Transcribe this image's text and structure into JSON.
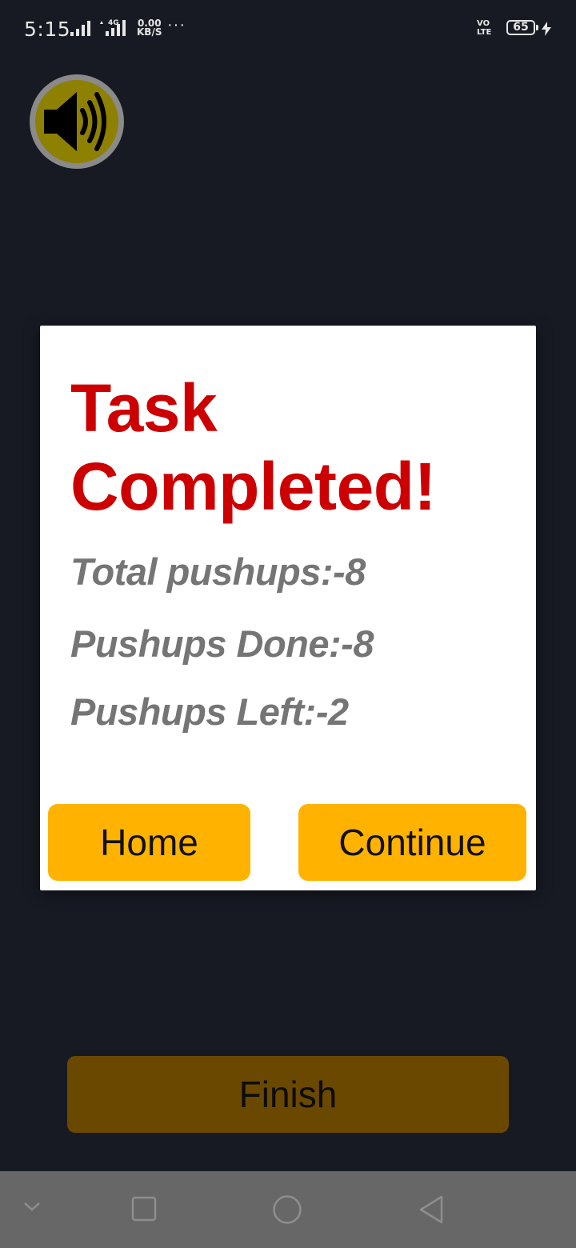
{
  "status_bar": {
    "time": "5:15",
    "speed_value": "0.00",
    "speed_unit": "KB/S",
    "more": "···",
    "volte_line1": "VO",
    "volte_line2": "LTE",
    "battery": "65"
  },
  "speaker": {
    "icon": "speaker-volume-icon",
    "color": "#8e8000"
  },
  "dialog": {
    "title": "Task Completed!",
    "stats": [
      "Total pushups:-8",
      "Pushups Done:-8",
      "Pushups Left:-2"
    ],
    "home_label": "Home",
    "continue_label": "Continue",
    "title_color": "#cc0000",
    "button_color": "#ffb300"
  },
  "finish_label": "Finish",
  "nav_bar": {
    "icons": [
      "chevron-down-icon",
      "recent-apps-icon",
      "home-icon",
      "back-icon"
    ]
  }
}
